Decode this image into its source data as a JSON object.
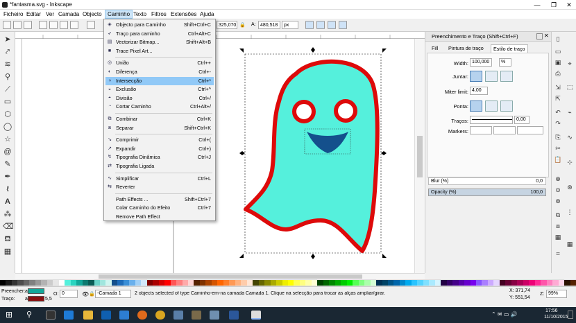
{
  "window": {
    "title": "*fantasma.svg - Inkscape",
    "controls": [
      "—",
      "❐",
      "✕"
    ]
  },
  "menubar": [
    "Ficheiro",
    "Editar",
    "Ver",
    "Camada",
    "Objecto",
    "Caminho",
    "Texto",
    "Filtros",
    "Extensões",
    "Ajuda"
  ],
  "toolbar": {
    "x_value": "325,070",
    "w_label": "L:",
    "h_label": "A:",
    "h_value": "480,518",
    "unit": "px"
  },
  "dropdown": {
    "groups": [
      [
        {
          "icon": "object-to-path-icon",
          "glyph": "◈",
          "label": "Objecto para Caminho",
          "shortcut": "Shift+Ctrl+C"
        },
        {
          "icon": "stroke-to-path-icon",
          "glyph": "➶",
          "label": "Traço para caminho",
          "shortcut": "Ctrl+Alt+C"
        },
        {
          "icon": "trace-bitmap-icon",
          "glyph": "▤",
          "label": "Vectorizar Bitmap...",
          "shortcut": "Shift+Alt+B"
        },
        {
          "icon": "trace-pixel-art-icon",
          "glyph": "■",
          "label": "Trace Pixel Art...",
          "shortcut": ""
        }
      ],
      [
        {
          "icon": "union-icon",
          "glyph": "◎",
          "label": "União",
          "shortcut": "Ctrl++"
        },
        {
          "icon": "difference-icon",
          "glyph": "◐",
          "label": "Diferença",
          "shortcut": "Ctrl+-"
        },
        {
          "icon": "intersection-icon",
          "glyph": "◑",
          "label": "Intersecção",
          "shortcut": "Ctrl+*",
          "highlight": true
        },
        {
          "icon": "exclusion-icon",
          "glyph": "◒",
          "label": "Exclusão",
          "shortcut": "Ctrl+^"
        },
        {
          "icon": "division-icon",
          "glyph": "◓",
          "label": "Divisão",
          "shortcut": "Ctrl+/"
        },
        {
          "icon": "cut-path-icon",
          "glyph": "◔",
          "label": "Cortar Caminho",
          "shortcut": "Ctrl+Alt+/"
        }
      ],
      [
        {
          "icon": "combine-icon",
          "glyph": "⧉",
          "label": "Combinar",
          "shortcut": "Ctrl+K"
        },
        {
          "icon": "break-apart-icon",
          "glyph": "⧈",
          "label": "Separar",
          "shortcut": "Shift+Ctrl+K"
        }
      ],
      [
        {
          "icon": "inset-icon",
          "glyph": "↘",
          "label": "Comprimir",
          "shortcut": "Ctrl+("
        },
        {
          "icon": "outset-icon",
          "glyph": "↗",
          "label": "Expandir",
          "shortcut": "Ctrl+)"
        },
        {
          "icon": "dynamic-offset-icon",
          "glyph": "↯",
          "label": "Tipografia Dinâmica",
          "shortcut": "Ctrl+J"
        },
        {
          "icon": "linked-offset-icon",
          "glyph": "⇄",
          "label": "Tipografia Ligada",
          "shortcut": ""
        }
      ],
      [
        {
          "icon": "simplify-icon",
          "glyph": "∿",
          "label": "Simplificar",
          "shortcut": "Ctrl+L"
        },
        {
          "icon": "reverse-icon",
          "glyph": "⇆",
          "label": "Reverter",
          "shortcut": ""
        }
      ],
      [
        {
          "icon": "path-effects-icon",
          "glyph": "",
          "label": "Path Effects ...",
          "shortcut": "Shift+Ctrl+7"
        },
        {
          "icon": "paste-path-effect-icon",
          "glyph": "",
          "label": "Colar Caminho do Efeito",
          "shortcut": "Ctrl+7"
        },
        {
          "icon": "remove-path-effect-icon",
          "glyph": "",
          "label": "Remove Path Effect",
          "shortcut": ""
        }
      ]
    ]
  },
  "panel": {
    "title": "Preenchimento e Traço (Shift+Ctrl+F)",
    "tabs": [
      "Fill",
      "Pintura de traço",
      "Estilo de traço"
    ],
    "width_label": "Width:",
    "width_value": "100,000",
    "width_unit": "%",
    "join_label": "Juntar:",
    "miter_label": "Miter limit:",
    "miter_value": "4,00",
    "cap_label": "Ponta:",
    "dashes_label": "Traços:",
    "dashes_value": "0,00",
    "markers_label": "Markers:",
    "blur_label": "Blur (%)",
    "blur_value": "0,0",
    "opacity_label": "Opacity (%)",
    "opacity_value": "100,0"
  },
  "status": {
    "fill_label": "Preencher:",
    "fill_value": "a",
    "stroke_label": "Traço:",
    "stroke_value": "a",
    "stroke_width": "5,5",
    "o_label": "O:",
    "o_value": "0",
    "layer": "-Camada 1",
    "message": "2 objects selected of type Caminho-em-na camada Camada 1. Clique na selecção para trocar as alças ampliar/girar.",
    "x_coord": "X: 371,74",
    "y_coord": "Y: 551,54",
    "zoom_label": "Z:",
    "zoom_value": "99%"
  },
  "taskbar": {
    "time": "17:56",
    "date": "11/10/2015"
  },
  "colors": {
    "ghost_fill": "#55f0dc",
    "ghost_stroke": "#dd0a0a",
    "mouth": "#14508c",
    "highlight": "#91c9f7"
  },
  "palette": [
    "#000000",
    "#1a1a1a",
    "#333333",
    "#4d4d4d",
    "#666666",
    "#808080",
    "#999999",
    "#b3b3b3",
    "#cccccc",
    "#e6e6e6",
    "#ffffff",
    "#55f0dc",
    "#2ad4c0",
    "#13a89a",
    "#0d7a70",
    "#0a5c55",
    "#6bd3c8",
    "#a0e6de",
    "#d0f5f0",
    "#14508c",
    "#1e6bb8",
    "#3a8ed6",
    "#6ab0ec",
    "#a2d0f6",
    "#d2e8fb",
    "#800000",
    "#aa0000",
    "#d40000",
    "#ff0000",
    "#ff5555",
    "#ff8080",
    "#ffaaaa",
    "#ffd5d5",
    "#552200",
    "#803300",
    "#aa4400",
    "#d45500",
    "#ff6600",
    "#ff7f2a",
    "#ff9955",
    "#ffb380",
    "#ffccaa",
    "#ffe6d5",
    "#444400",
    "#666600",
    "#888800",
    "#aaaa00",
    "#cccc00",
    "#eeee00",
    "#ffff00",
    "#ffff55",
    "#ffff80",
    "#ffffaa",
    "#ffffd5",
    "#004400",
    "#006600",
    "#008800",
    "#00aa00",
    "#00cc00",
    "#00ee00",
    "#55ff55",
    "#80ff80",
    "#aaffaa",
    "#d5ffd5",
    "#003355",
    "#004466",
    "#005588",
    "#0066aa",
    "#0088cc",
    "#00aaee",
    "#2ac4ff",
    "#55d4ff",
    "#80e0ff",
    "#aaeaff",
    "#d5f4ff",
    "#220044",
    "#330066",
    "#440088",
    "#5500aa",
    "#6600cc",
    "#7700ee",
    "#8855ff",
    "#aa80ff",
    "#ccaaff",
    "#e5d5ff",
    "#440022",
    "#660033",
    "#880044",
    "#aa0055",
    "#cc0066",
    "#ee0077",
    "#ff2a95",
    "#ff55aa",
    "#ff80bf",
    "#ffaad4",
    "#ffd5ea",
    "#2b1100",
    "#552200"
  ]
}
